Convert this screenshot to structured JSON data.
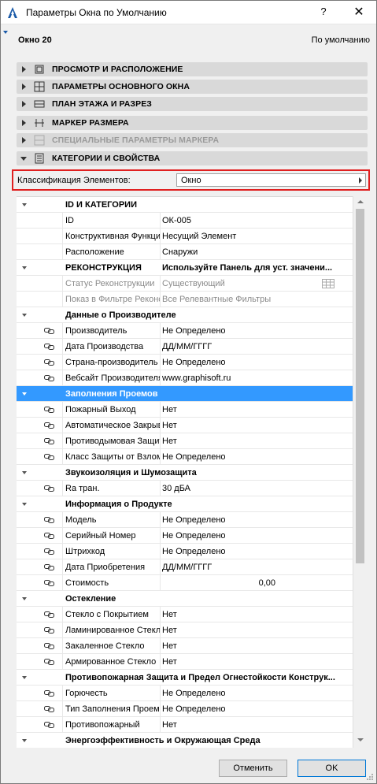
{
  "window": {
    "title": "Параметры Окна по Умолчанию",
    "help": "?",
    "close": "✕",
    "element_name": "Окно 20",
    "default_label": "По умолчанию"
  },
  "panels": [
    {
      "label": "ПРОСМОТР И РАСПОЛОЖЕНИЕ",
      "icon": "view-placement-icon",
      "expanded": false,
      "disabled": false
    },
    {
      "label": "ПАРАМЕТРЫ ОСНОВНОГО ОКНА",
      "icon": "window-params-icon",
      "expanded": false,
      "disabled": false
    },
    {
      "label": "ПЛАН ЭТАЖА И РАЗРЕЗ",
      "icon": "floor-plan-icon",
      "expanded": false,
      "disabled": false
    },
    {
      "label": "МАРКЕР РАЗМЕРА",
      "icon": "dimension-marker-icon",
      "expanded": false,
      "disabled": false
    },
    {
      "label": "СПЕЦИАЛЬНЫЕ ПАРАМЕТРЫ МАРКЕРА",
      "icon": "marker-params-icon",
      "expanded": false,
      "disabled": true
    },
    {
      "label": "КАТЕГОРИИ И СВОЙСТВА",
      "icon": "categories-icon",
      "expanded": true,
      "disabled": false
    }
  ],
  "classification": {
    "label": "Классификация Элементов:",
    "value": "Окно"
  },
  "tree": [
    {
      "type": "group",
      "name": "ID И КАТЕГОРИИ",
      "value": ""
    },
    {
      "type": "item",
      "name": "ID",
      "value": "ОК-005"
    },
    {
      "type": "item",
      "name": "Конструктивная Функция",
      "value": "Несущий Элемент"
    },
    {
      "type": "item",
      "name": "Расположение",
      "value": "Снаружи"
    },
    {
      "type": "group",
      "name": "РЕКОНСТРУКЦИЯ",
      "value": "Используйте Панель для уст. значени..."
    },
    {
      "type": "item",
      "name": "Статус Реконструкции",
      "value": "Существующий",
      "disabled": true,
      "table": true
    },
    {
      "type": "item",
      "name": "Показ в Фильтре Реконструкции",
      "value": "Все Релевантные Фильтры",
      "disabled": true
    },
    {
      "type": "group",
      "name": "Данные о Производителе",
      "value": ""
    },
    {
      "type": "item",
      "name": "Производитель",
      "value": "Не Определено",
      "link": true
    },
    {
      "type": "item",
      "name": "Дата Производства",
      "value": "ДД/ММ/ГГГГ",
      "link": true
    },
    {
      "type": "item",
      "name": "Страна-производитель",
      "value": "Не Определено",
      "link": true
    },
    {
      "type": "item",
      "name": "Вебсайт Производителя",
      "value": "www.graphisoft.ru",
      "link": true
    },
    {
      "type": "group",
      "name": "Заполнения Проемов",
      "value": "",
      "selected": true
    },
    {
      "type": "item",
      "name": "Пожарный Выход",
      "value": "Нет",
      "link": true
    },
    {
      "type": "item",
      "name": "Автоматическое Закрывание",
      "value": "Нет",
      "link": true
    },
    {
      "type": "item",
      "name": "Противодымовая Защита",
      "value": "Нет",
      "link": true
    },
    {
      "type": "item",
      "name": "Класс Защиты от Взлома",
      "value": "Не Определено",
      "link": true
    },
    {
      "type": "group",
      "name": "Звукоизоляция и Шумозащита",
      "value": ""
    },
    {
      "type": "item",
      "name": "Ra тран.",
      "value": "30 дБА",
      "link": true
    },
    {
      "type": "group",
      "name": "Информация о Продукте",
      "value": ""
    },
    {
      "type": "item",
      "name": "Модель",
      "value": "Не Определено",
      "link": true
    },
    {
      "type": "item",
      "name": "Серийный Номер",
      "value": "Не Определено",
      "link": true
    },
    {
      "type": "item",
      "name": "Штрихкод",
      "value": "Не Определено",
      "link": true
    },
    {
      "type": "item",
      "name": "Дата Приобретения",
      "value": "ДД/ММ/ГГГГ",
      "link": true
    },
    {
      "type": "item",
      "name": "Стоимость",
      "value": "",
      "number": "0,00",
      "link": true
    },
    {
      "type": "group",
      "name": "Остекление",
      "value": ""
    },
    {
      "type": "item",
      "name": "Стекло с Покрытием",
      "value": "Нет",
      "link": true
    },
    {
      "type": "item",
      "name": "Ламинированное Стекло",
      "value": "Нет",
      "link": true
    },
    {
      "type": "item",
      "name": "Закаленное Стекло",
      "value": "Нет",
      "link": true
    },
    {
      "type": "item",
      "name": "Армированное Стекло",
      "value": "Нет",
      "link": true
    },
    {
      "type": "group",
      "name": "Противопожарная Защита и Предел Огнестойкости Конструк...",
      "value": ""
    },
    {
      "type": "item",
      "name": "Горючесть",
      "value": "Не Определено",
      "link": true
    },
    {
      "type": "item",
      "name": "Тип Заполнения Проема",
      "value": "Не Определено",
      "link": true
    },
    {
      "type": "item",
      "name": "Противопожарный",
      "value": "Нет",
      "link": true
    },
    {
      "type": "group",
      "name": "Энергоэффективность и Окружающая Среда",
      "value": ""
    }
  ],
  "buttons": {
    "cancel": "Отменить",
    "ok": "OK"
  },
  "colors": {
    "selection": "#3399ff",
    "highlight_border": "#e02020"
  }
}
